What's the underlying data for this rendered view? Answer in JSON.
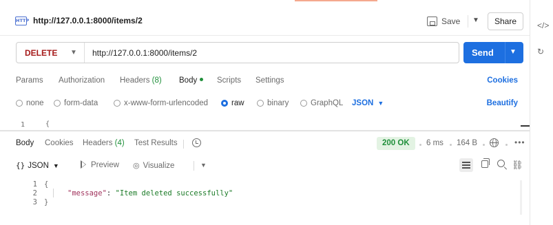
{
  "request": {
    "title": "http://127.0.0.1:8000/items/2",
    "method": "DELETE",
    "url": "http://127.0.0.1:8000/items/2",
    "save_label": "Save",
    "share_label": "Share",
    "send_label": "Send",
    "http_badge": "HTTP"
  },
  "request_tabs": {
    "params": "Params",
    "authorization": "Authorization",
    "headers": "Headers",
    "headers_count": "(8)",
    "body": "Body",
    "scripts": "Scripts",
    "settings": "Settings",
    "cookies": "Cookies"
  },
  "body_types": {
    "none": "none",
    "form_data": "form-data",
    "urlencoded": "x-www-form-urlencoded",
    "raw": "raw",
    "binary": "binary",
    "graphql": "GraphQL",
    "language": "JSON",
    "beautify": "Beautify"
  },
  "editor": {
    "line_number": "1",
    "first_char": "{"
  },
  "response_tabs": {
    "body": "Body",
    "cookies": "Cookies",
    "headers": "Headers",
    "headers_count": "(4)",
    "test_results": "Test Results",
    "status": "200 OK",
    "time": "6 ms",
    "size": "164 B"
  },
  "response_toolbar": {
    "format_braces": "{}",
    "format_label": "JSON",
    "preview": "Preview",
    "visualize": "Visualize"
  },
  "response_body": {
    "lines": [
      {
        "num": "1",
        "text": "{"
      },
      {
        "num": "2",
        "key": "\"message\"",
        "colon": ": ",
        "value": "\"Item deleted successfully\""
      },
      {
        "num": "3",
        "text": "}"
      }
    ]
  },
  "colors": {
    "accent": "#1d6fe0",
    "method_delete": "#a61b1b",
    "success": "#1f8f3a"
  }
}
